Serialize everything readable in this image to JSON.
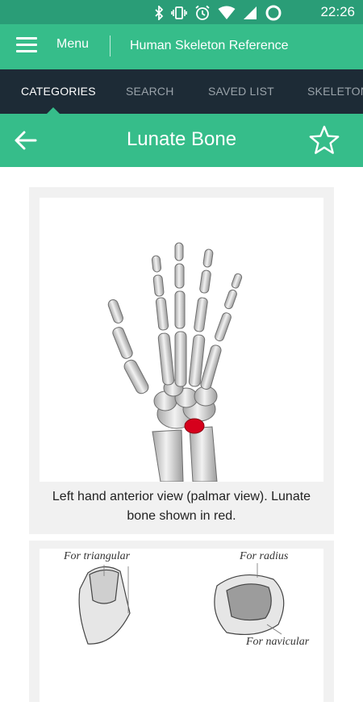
{
  "status_bar": {
    "time": "22:26",
    "icons": [
      "bluetooth-icon",
      "vibrate-icon",
      "alarm-icon",
      "wifi-icon",
      "signal-icon",
      "battery-icon"
    ]
  },
  "app_bar": {
    "menu_label": "Menu",
    "title": "Human Skeleton Reference"
  },
  "tabs": [
    {
      "label": "CATEGORIES",
      "active": true
    },
    {
      "label": "SEARCH",
      "active": false
    },
    {
      "label": "SAVED LIST",
      "active": false
    },
    {
      "label": "SKELETON",
      "active": false
    }
  ],
  "page": {
    "title": "Lunate Bone"
  },
  "figures": [
    {
      "caption": "Left hand anterior view (palmar view). Lunate bone shown in red."
    },
    {
      "labels": [
        "For triangular",
        "For radius",
        "For navicular"
      ]
    }
  ],
  "colors": {
    "primary": "#36bd8a",
    "status_bar": "#2a9d77",
    "tab_bar": "#1d2b36",
    "highlight_bone": "#d6001c"
  }
}
